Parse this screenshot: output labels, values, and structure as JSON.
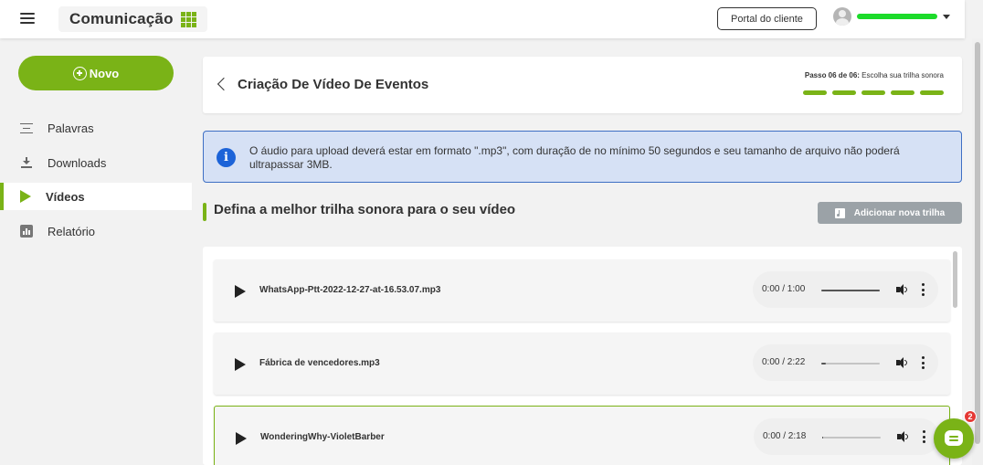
{
  "topbar": {
    "brand": "Comunicação",
    "portal_button": "Portal do cliente",
    "username": ""
  },
  "sidebar": {
    "new_button": "Novo",
    "items": [
      {
        "label": "Palavras",
        "icon": "list-lines-icon"
      },
      {
        "label": "Downloads",
        "icon": "download-icon"
      },
      {
        "label": "Vídeos",
        "icon": "play-icon",
        "active": true
      },
      {
        "label": "Relatório",
        "icon": "bar-chart-icon"
      }
    ]
  },
  "header": {
    "title": "Criação De Vídeo De Eventos",
    "step_prefix": "Passo 06 de 06:",
    "step_text": " Escolha sua trilha sonora",
    "steps_total": 5,
    "steps_done": 5
  },
  "alert": {
    "text": "O áudio para upload deverá estar em formato \".mp3\", com duração de no mínimo 50 segundos e seu tamanho de arquivo não poderá ultrapassar 3MB."
  },
  "section": {
    "title": "Defina a melhor trilha sonora para o seu vídeo",
    "add_button": "Adicionar nova trilha"
  },
  "tracks": [
    {
      "name": "WhatsApp-Ptt-2022-12-27-at-16.53.07.mp3",
      "time": "0:00 / 1:00",
      "progress": 1.0,
      "selected": false
    },
    {
      "name": "Fábrica de vencedores.mp3",
      "time": "0:00 / 2:22",
      "progress": 0.08,
      "selected": false
    },
    {
      "name": "WonderingWhy-VioletBarber",
      "time": "0:00 / 2:18",
      "progress": 0.02,
      "selected": true
    }
  ],
  "chat": {
    "badge": "2"
  },
  "colors": {
    "accent": "#7ab317",
    "alert_bg": "#d6e1f5",
    "alert_border": "#3e6fc4",
    "info_icon": "#1c63d8",
    "badge": "#e53935"
  }
}
